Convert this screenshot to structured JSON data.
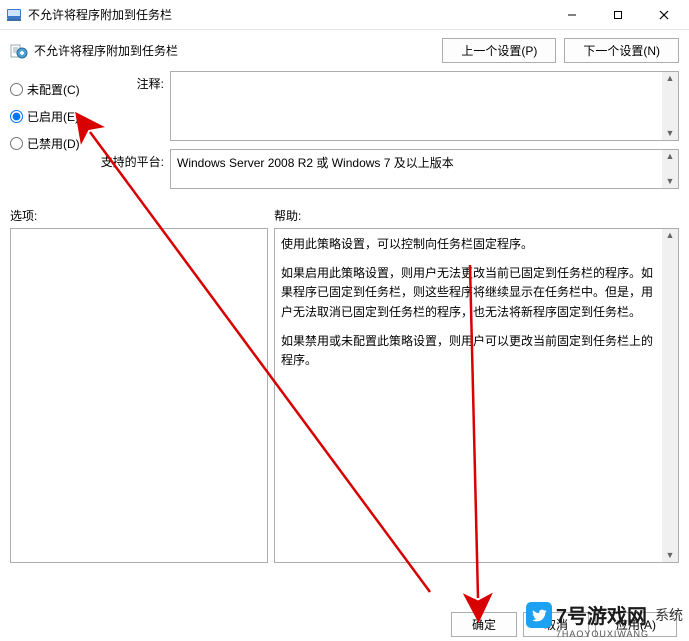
{
  "window": {
    "title": "不允许将程序附加到任务栏"
  },
  "header": {
    "policy_name": "不允许将程序附加到任务栏",
    "prev_setting_btn": "上一个设置(P)",
    "next_setting_btn": "下一个设置(N)"
  },
  "state": {
    "not_configured": "未配置(C)",
    "enabled": "已启用(E)",
    "disabled": "已禁用(D)",
    "selected": "enabled"
  },
  "fields": {
    "comment_label": "注释:",
    "comment_text": "",
    "platform_label": "支持的平台:",
    "platform_text": "Windows Server 2008 R2 或 Windows 7 及以上版本"
  },
  "sections": {
    "options_label": "选项:",
    "help_label": "帮助:"
  },
  "help": {
    "p1": "使用此策略设置，可以控制向任务栏固定程序。",
    "p2": "如果启用此策略设置，则用户无法更改当前已固定到任务栏的程序。如果程序已固定到任务栏，则这些程序将继续显示在任务栏中。但是，用户无法取消已固定到任务栏的程序，也无法将新程序固定到任务栏。",
    "p3": "如果禁用或未配置此策略设置，则用户可以更改当前固定到任务栏上的程序。"
  },
  "footer": {
    "ok": "确定",
    "cancel": "取消",
    "apply": "应用(A)"
  },
  "watermark": {
    "main": "7号游戏网",
    "sub": "7HAOYOUXIWANG",
    "extra": "系统"
  }
}
